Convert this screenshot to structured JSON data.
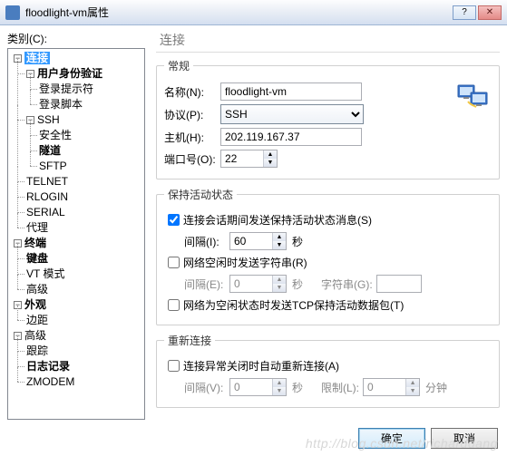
{
  "window": {
    "title": "floodlight-vm属性",
    "help_icon": "help-icon",
    "close_icon": "close-icon"
  },
  "sidebar": {
    "label": "类别(C):",
    "tree": {
      "connection": "连接",
      "user_auth": "用户身份验证",
      "login_prompt": "登录提示符",
      "login_script": "登录脚本",
      "ssh": "SSH",
      "security": "安全性",
      "tunnel": "隧道",
      "sftp": "SFTP",
      "telnet": "TELNET",
      "rlogin": "RLOGIN",
      "serial": "SERIAL",
      "proxy": "代理",
      "terminal": "终端",
      "keyboard": "键盘",
      "vt_mode": "VT 模式",
      "advanced_term": "高级",
      "appearance": "外观",
      "margins": "边距",
      "advanced": "高级",
      "trace": "跟踪",
      "logging": "日志记录",
      "zmodem": "ZMODEM"
    }
  },
  "panel": {
    "title": "连接",
    "general": {
      "legend": "常规",
      "name_label": "名称(N):",
      "name_value": "floodlight-vm",
      "protocol_label": "协议(P):",
      "protocol_value": "SSH",
      "host_label": "主机(H):",
      "host_value": "202.119.167.37",
      "port_label": "端口号(O):",
      "port_value": "22"
    },
    "keepalive": {
      "legend": "保持活动状态",
      "send_keepalive": "连接会话期间发送保持活动状态消息(S)",
      "interval_label": "间隔(I):",
      "interval_value": "60",
      "seconds": "秒",
      "idle_string": "网络空闲时发送字符串(R)",
      "idle_interval_label": "间隔(E):",
      "idle_interval_value": "0",
      "string_label": "字符串(G):",
      "string_value": "",
      "idle_tcp": "网络为空闲状态时发送TCP保持活动数据包(T)"
    },
    "reconnect": {
      "legend": "重新连接",
      "auto_reconnect": "连接异常关闭时自动重新连接(A)",
      "interval_label": "间隔(V):",
      "interval_value": "0",
      "seconds": "秒",
      "limit_label": "限制(L):",
      "limit_value": "0",
      "minutes": "分钟"
    }
  },
  "buttons": {
    "ok": "确定",
    "cancel": "取消"
  },
  "watermark": "http://blog.csdn.net/richarddang"
}
